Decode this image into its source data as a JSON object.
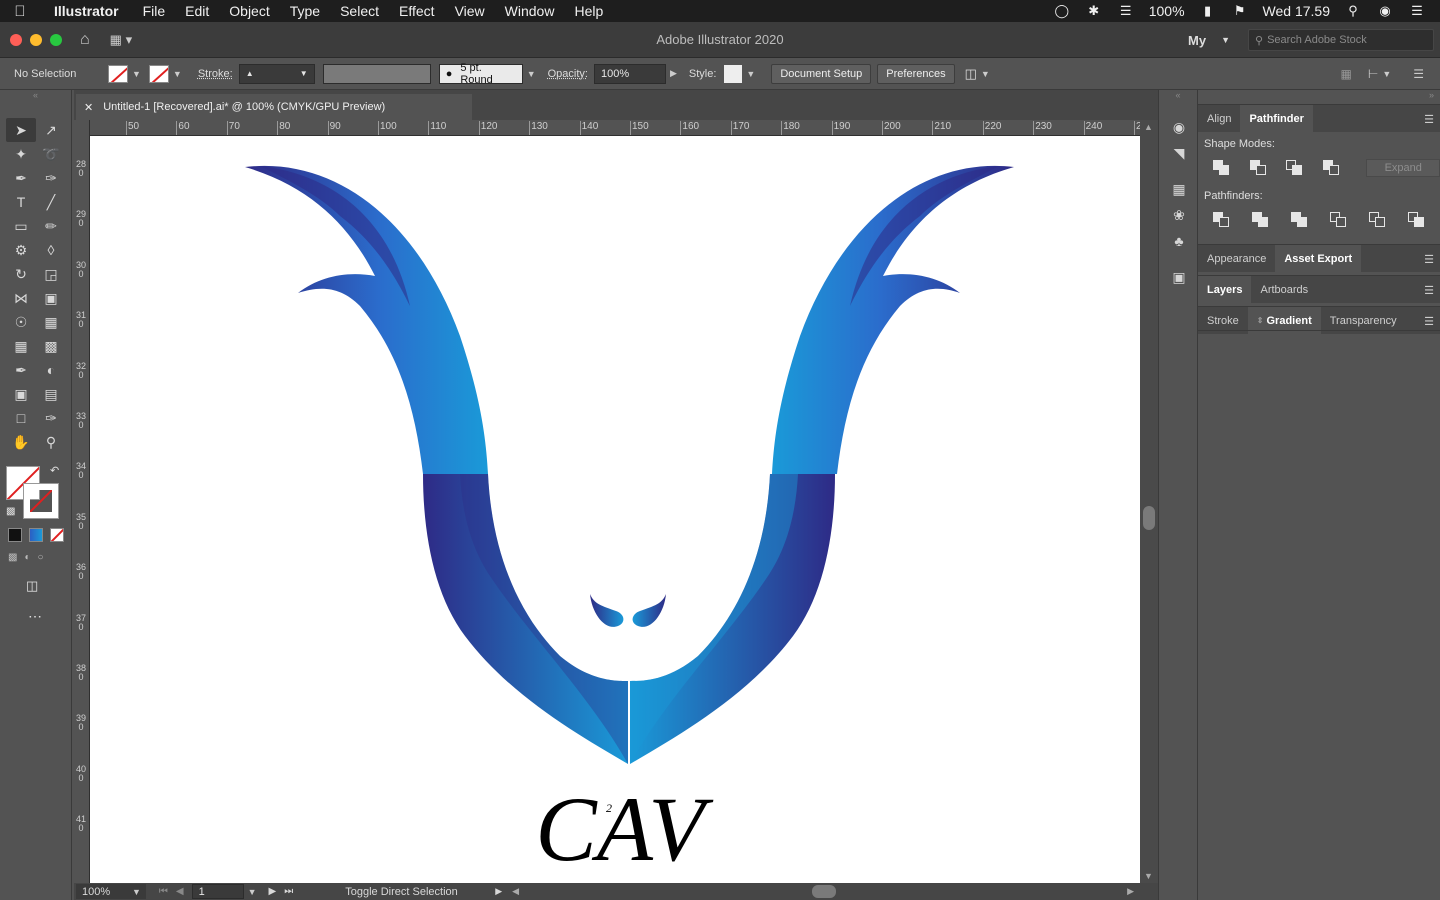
{
  "menubar": {
    "app_name": "Illustrator",
    "items": [
      "File",
      "Edit",
      "Object",
      "Type",
      "Select",
      "Effect",
      "View",
      "Window",
      "Help"
    ],
    "battery": "100%",
    "clock": "Wed 17.59"
  },
  "titlebar": {
    "title": "Adobe Illustrator 2020",
    "workspace": "My",
    "search_placeholder": "Search Adobe Stock"
  },
  "controlbar": {
    "selection": "No Selection",
    "stroke_label": "Stroke:",
    "brush": "5 pt. Round",
    "opacity_label": "Opacity:",
    "opacity_value": "100%",
    "style_label": "Style:",
    "document_setup": "Document Setup",
    "preferences": "Preferences"
  },
  "document": {
    "tab_title": "Untitled-1 [Recovered].ai* @ 100% (CMYK/GPU Preview)",
    "ruler_ticks": [
      "50",
      "60",
      "70",
      "80",
      "90",
      "100",
      "110",
      "120",
      "130",
      "140",
      "150",
      "160",
      "170",
      "180",
      "190",
      "200",
      "210",
      "220",
      "230",
      "240",
      "2"
    ],
    "ruler_left": [
      "280",
      "290",
      "300",
      "310",
      "320",
      "330",
      "340",
      "350",
      "360",
      "370",
      "380",
      "390",
      "400",
      "410"
    ],
    "logo_text": "CAV",
    "logo_superscript": "2"
  },
  "statusbar": {
    "zoom": "100%",
    "artboard": "1",
    "status": "Toggle Direct Selection"
  },
  "panels": {
    "group1_tabs": [
      "Align",
      "Pathfinder"
    ],
    "shape_modes": "Shape Modes:",
    "pathfinders": "Pathfinders:",
    "expand": "Expand",
    "group2_tabs": [
      "Appearance",
      "Asset Export"
    ],
    "group3_tabs": [
      "Layers",
      "Artboards"
    ],
    "group4_tabs": [
      "Stroke",
      "Gradient",
      "Transparency"
    ]
  },
  "colors": {
    "gradient_dark": "#2e2a86",
    "gradient_light": "#1a9ad8",
    "gradient_mid": "#2b5fc4"
  }
}
